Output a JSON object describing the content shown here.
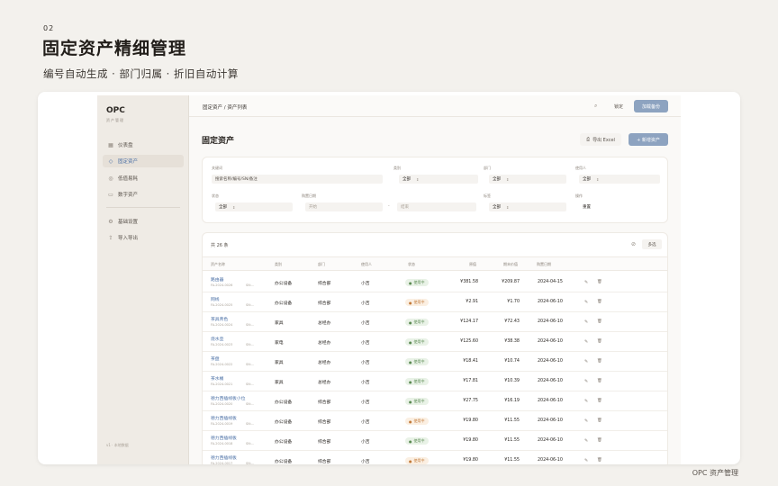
{
  "slide": {
    "number": "02",
    "title": "固定资产精细管理",
    "subtitle": "编号自动生成 · 部门归属 · 折旧自动计算",
    "footer": "OPC 资产管理"
  },
  "app": {
    "logo": "OPC",
    "logo_sub": "资产管理",
    "sidebar_footer": "v1 · 本地数据",
    "nav": [
      {
        "label": "仪表盘",
        "icon": "dashboard-icon",
        "glyph": "▦"
      },
      {
        "label": "固定资产",
        "icon": "box-icon",
        "glyph": "◇"
      },
      {
        "label": "低值易耗",
        "icon": "package-icon",
        "glyph": "◎"
      },
      {
        "label": "数字资产",
        "icon": "monitor-icon",
        "glyph": "▭"
      },
      {
        "label": "基础设置",
        "icon": "settings-icon",
        "glyph": "⚙"
      },
      {
        "label": "导入导出",
        "icon": "upload-icon",
        "glyph": "⇪"
      }
    ],
    "breadcrumb": "固定资产 / 资产列表",
    "topbar": {
      "search_icon": "⌕",
      "lock_label": "锁定",
      "button_label": "加载备份"
    },
    "page_title": "固定资产",
    "export_label": "导出 Excel",
    "add_label": "+ 新增资产",
    "filters": {
      "keyword_label": "关键词",
      "keyword_placeholder": "搜索名称/编号/SN/备注",
      "category_label": "类别",
      "category_value": "全部",
      "dept_label": "部门",
      "dept_value": "全部",
      "user_label": "使用人",
      "user_value": "全部",
      "status_label": "状态",
      "status_value": "全部",
      "date_label": "购置日期",
      "date_start": "开始",
      "date_sep": "-",
      "date_end": "结束",
      "tag_label": "标签",
      "tag_value": "全部",
      "op_label": "操作",
      "reset_label": "重置"
    },
    "table": {
      "count": "共 26 条",
      "check_icon": "⊘",
      "multi_label": "多选",
      "headers": [
        "资产名称",
        "类别",
        "部门",
        "使用人",
        "状态",
        "原值",
        "期末价值",
        "购置日期"
      ],
      "rows": [
        {
          "name": "路由器",
          "code": "FA-2024-0026",
          "extra": "SN:...",
          "cat": "办公设备",
          "dept": "综合部",
          "user": "小吉",
          "status": "使用中",
          "tone": "green",
          "orig": "¥381.58",
          "net": "¥209.87",
          "date": "2024-04-15"
        },
        {
          "name": "网线",
          "code": "FA-2024-0025",
          "extra": "SN:...",
          "cat": "办公设备",
          "dept": "综合部",
          "user": "小吉",
          "status": "使用中",
          "tone": "orange",
          "orig": "¥2.91",
          "net": "¥1.70",
          "date": "2024-06-10"
        },
        {
          "name": "茶具青色",
          "code": "FA-2024-0024",
          "extra": "SN:...",
          "cat": "家具",
          "dept": "总经办",
          "user": "小吉",
          "status": "使用中",
          "tone": "green",
          "orig": "¥124.17",
          "net": "¥72.43",
          "date": "2024-06-10"
        },
        {
          "name": "烧水壶",
          "code": "FA-2024-0023",
          "extra": "SN:...",
          "cat": "家电",
          "dept": "总经办",
          "user": "小吉",
          "status": "使用中",
          "tone": "green",
          "orig": "¥125.60",
          "net": "¥38.38",
          "date": "2024-06-10"
        },
        {
          "name": "茶盘",
          "code": "FA-2024-0022",
          "extra": "SN:...",
          "cat": "家具",
          "dept": "总经办",
          "user": "小吉",
          "status": "使用中",
          "tone": "green",
          "orig": "¥18.41",
          "net": "¥10.74",
          "date": "2024-06-10"
        },
        {
          "name": "茶水桶",
          "code": "FA-2024-0021",
          "extra": "SN:...",
          "cat": "家具",
          "dept": "总经办",
          "user": "小吉",
          "status": "使用中",
          "tone": "green",
          "orig": "¥17.81",
          "net": "¥10.39",
          "date": "2024-06-10"
        },
        {
          "name": "德力西插线板小位",
          "code": "FA-2024-0020",
          "extra": "SN:...",
          "cat": "办公设备",
          "dept": "综合部",
          "user": "小吉",
          "status": "使用中",
          "tone": "green",
          "orig": "¥27.75",
          "net": "¥16.19",
          "date": "2024-06-10"
        },
        {
          "name": "德力西插线板",
          "code": "FA-2024-0019",
          "extra": "SN:...",
          "cat": "办公设备",
          "dept": "综合部",
          "user": "小吉",
          "status": "使用中",
          "tone": "orange",
          "orig": "¥19.80",
          "net": "¥11.55",
          "date": "2024-06-10"
        },
        {
          "name": "德力西插线板",
          "code": "FA-2024-0018",
          "extra": "SN:...",
          "cat": "办公设备",
          "dept": "综合部",
          "user": "小吉",
          "status": "使用中",
          "tone": "green",
          "orig": "¥19.80",
          "net": "¥11.55",
          "date": "2024-06-10"
        },
        {
          "name": "德力西插线板",
          "code": "FA-2024-0017",
          "extra": "SN:...",
          "cat": "办公设备",
          "dept": "综合部",
          "user": "小吉",
          "status": "使用中",
          "tone": "orange",
          "orig": "¥19.80",
          "net": "¥11.55",
          "date": "2024-06-10"
        }
      ],
      "edit_icon": "✎",
      "delete_icon": "🗑"
    }
  }
}
